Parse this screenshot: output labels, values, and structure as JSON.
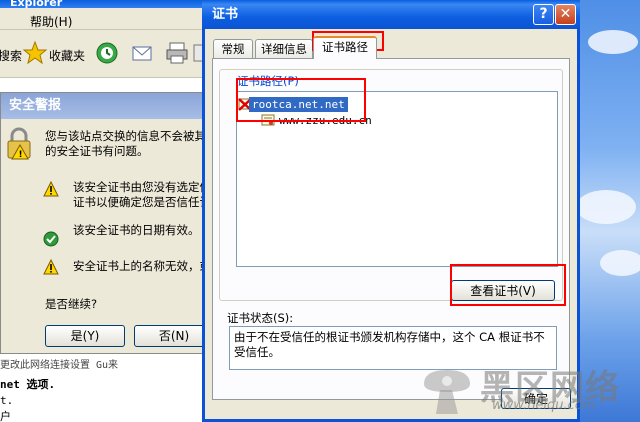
{
  "ie_window": {
    "title": "Explorer",
    "menu": {
      "help": "帮助(H)"
    },
    "toolbar": {
      "search": "搜索",
      "favorites": "收藏夹"
    },
    "content_lines": [
      "更改此网络连接设置 Gu来",
      "net 选项.",
      "t.",
      "户"
    ]
  },
  "security_alert": {
    "title": "安全警报",
    "intro_line1": "您与该站点交换的信息不会被其它",
    "intro_line2": "的安全证书有问题。",
    "item1_line1": "该安全证书由您没有选定信",
    "item1_line2": "证书以便确定您是否信任该",
    "item2": "该安全证书的日期有效。",
    "item3": "安全证书上的名称无效，或",
    "continue_question": "是否继续?",
    "yes_button": "是(Y)",
    "no_button": "否(N)"
  },
  "cert_dialog": {
    "title": "证书",
    "help_glyph": "?",
    "close_glyph": "✕",
    "tabs": [
      "常规",
      "详细信息",
      "证书路径"
    ],
    "active_tab": 2,
    "path_label": "证书路径(P)",
    "tree": {
      "root": "rootca.net.net",
      "child": "www.zzu.edu.cn"
    },
    "view_cert_button": "查看证书(V)",
    "status_label": "证书状态(S):",
    "status_text": "由于不在受信任的根证书颁发机构存储中，这个 CA 根证书不受信任。",
    "ok_button": "确定"
  },
  "watermark": {
    "brand": "黑区网络",
    "url": "www.heiqu.com"
  },
  "colors": {
    "titlebar": "#0a5fe0",
    "highlight": "#ff0000",
    "selection": "#316ac5"
  }
}
